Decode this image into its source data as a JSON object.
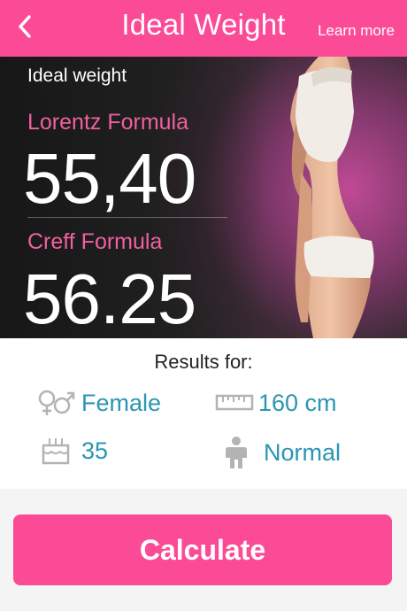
{
  "header": {
    "title": "Ideal Weight",
    "learn_more": "Learn more"
  },
  "hero": {
    "label": "Ideal weight",
    "lorentz": {
      "name": "Lorentz Formula",
      "value": "55,40"
    },
    "creff": {
      "name": "Creff Formula",
      "value": "56.25"
    }
  },
  "results": {
    "title": "Results for:",
    "gender": "Female",
    "height": "160 cm",
    "age": "35",
    "build": "Normal"
  },
  "actions": {
    "calculate": "Calculate"
  },
  "colors": {
    "accent": "#fb4b96",
    "value": "#2a96b3",
    "formula": "#f0609f"
  }
}
